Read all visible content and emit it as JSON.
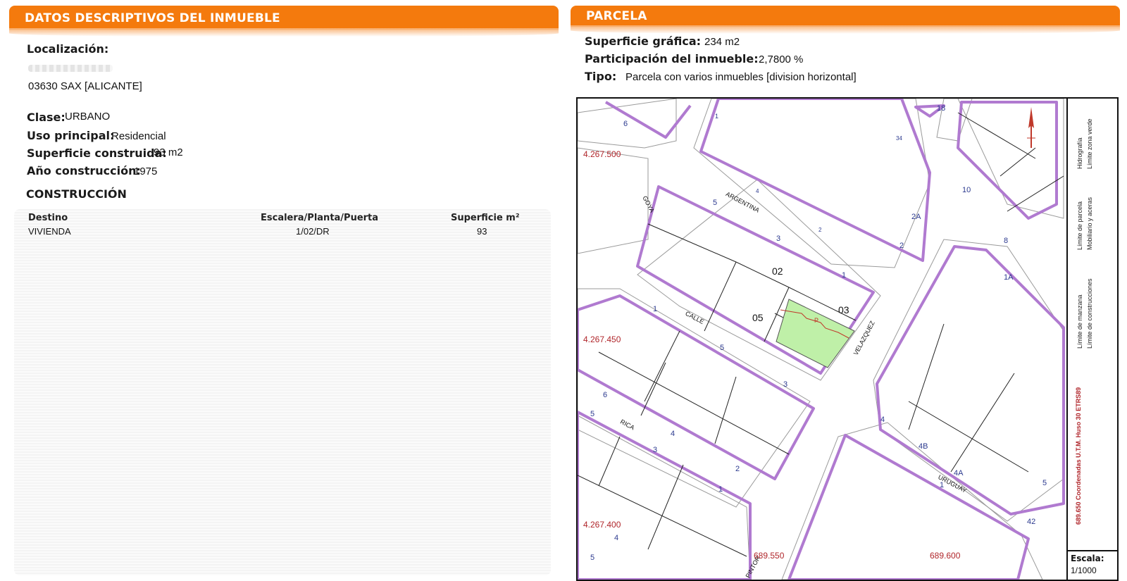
{
  "left": {
    "header": "DATOS DESCRIPTIVOS DEL INMUEBLE",
    "localizacion_label": "Localización:",
    "localizacion_value": "03630 SAX [ALICANTE]",
    "clase_label": "Clase:",
    "clase_value": "URBANO",
    "uso_label": "Uso principal:",
    "uso_value": "Residencial",
    "superficie_label": "Superficie construida:",
    "superficie_value": "93 m2",
    "anio_label": "Año construcción:",
    "anio_value": "1975",
    "construccion_title": "CONSTRUCCIÓN",
    "table": {
      "headers": [
        "Destino",
        "Escalera/Planta/Puerta",
        "Superficie m²"
      ],
      "rows": [
        [
          "VIVIENDA",
          "1/02/DR",
          "93"
        ]
      ]
    }
  },
  "right": {
    "header": "PARCELA",
    "superficie_label": "Superficie gráfica:",
    "superficie_value": "234 m2",
    "participacion_label": "Participación del inmueble:",
    "participacion_value": "2,7800 %",
    "tipo_label": "Tipo:",
    "tipo_value": "Parcela con varios inmuebles [division horizontal]"
  },
  "map": {
    "streets": [
      "GOYA",
      "ARGENTINA",
      "CALLE",
      "VELAZQUEZ",
      "RICA",
      "URUGUAY",
      "PINTOR"
    ],
    "parcel_ids": [
      "02",
      "03",
      "05"
    ],
    "parcel_marker": "P",
    "house_numbers": [
      "6",
      "1",
      "18",
      "34",
      "10",
      "4",
      "5",
      "2",
      "3",
      "2",
      "2A",
      "8",
      "1",
      "1A",
      "1",
      "5",
      "3",
      "6",
      "5",
      "4",
      "3",
      "2",
      "1",
      "4",
      "4B",
      "4A",
      "1",
      "42",
      "5",
      "4",
      "5"
    ],
    "coordinates": {
      "y1": "4.267.500",
      "y2": "4.267.450",
      "y3": "4.267.400",
      "x1": "689.550",
      "x2": "689.600",
      "x_vertical": "689.650",
      "crs": "Coordenadas U.T.M. Huso 30 ETRS89"
    },
    "legend": {
      "items": [
        "Límite de manzana",
        "Límite de parcela",
        "Límite de construcciones",
        "Mobiliario y aceras",
        "Límite zona verde",
        "Hidrografía"
      ],
      "scale_label": "Escala:",
      "scale_value": "1/1000"
    },
    "colors": {
      "manzana": "#b07ad0",
      "parcel_highlight": "#bff0a8",
      "coordinate_text": "#b0262b",
      "number_text": "#2c3a8f"
    }
  }
}
